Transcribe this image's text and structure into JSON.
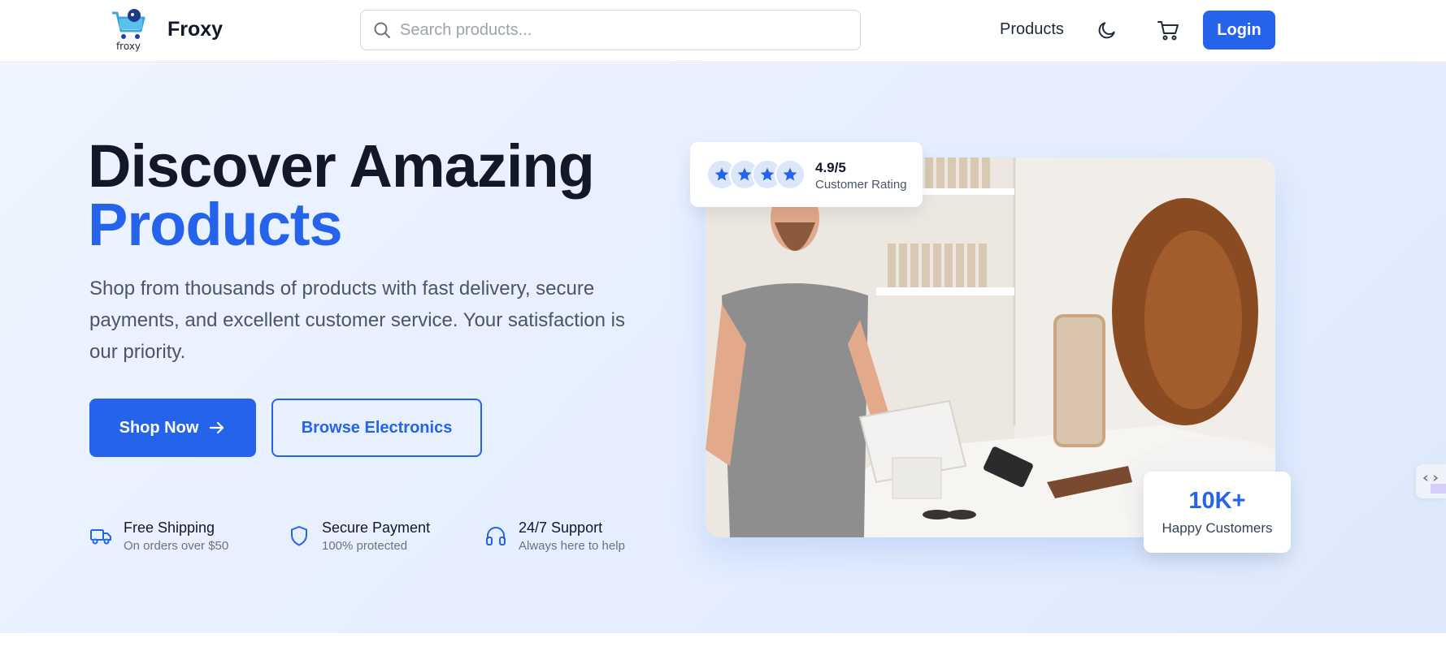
{
  "header": {
    "logo_caption": "froxy",
    "brand": "Froxy",
    "search_placeholder": "Search products...",
    "nav_products": "Products",
    "login_label": "Login"
  },
  "hero": {
    "title_line1": "Discover Amazing",
    "title_line2": "Products",
    "description": "Shop from thousands of products with fast delivery, secure payments, and excellent customer service. Your satisfaction is our priority.",
    "shop_now_label": "Shop Now",
    "browse_label": "Browse Electronics",
    "features": [
      {
        "title": "Free Shipping",
        "subtitle": "On orders over $50",
        "icon": "truck-icon"
      },
      {
        "title": "Secure Payment",
        "subtitle": "100% protected",
        "icon": "shield-icon"
      },
      {
        "title": "24/7 Support",
        "subtitle": "Always here to help",
        "icon": "headphones-icon"
      }
    ],
    "rating": {
      "value": "4.9/5",
      "label": "Customer Rating",
      "stars_shown": 4
    },
    "customers": {
      "value": "10K+",
      "label": "Happy Customers"
    }
  },
  "colors": {
    "accent": "#2563eb",
    "text_dark": "#111827",
    "hero_bg": "#e6efff"
  }
}
